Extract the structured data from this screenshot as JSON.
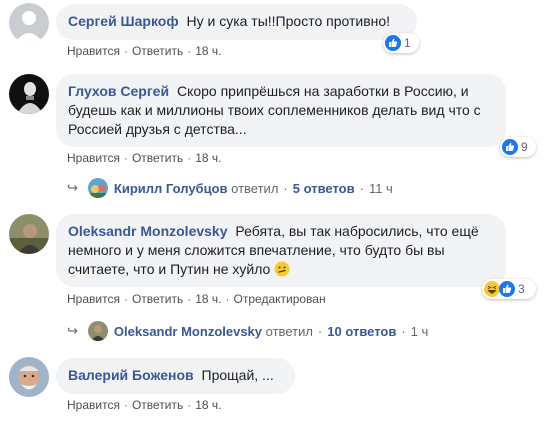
{
  "colors": {
    "link": "#385898",
    "bubble": "#f2f3f5",
    "muted": "#606770",
    "like_blue": "#1877f2"
  },
  "labels": {
    "like": "Нравится",
    "reply": "Ответить",
    "dot": "·",
    "replied_suffix": "ответил"
  },
  "comments": [
    {
      "author": "Сергей Шаркоф",
      "text": "Ну и сука ты!!Просто противно!",
      "time": "18 ч.",
      "reaction_icons": [
        "like-icon"
      ],
      "reaction_count": "1"
    },
    {
      "author": "Глухов Сергей",
      "text": "Скоро припрёшься на заработки в Россию, и будешь как и миллионы твоих соплеменников делать вид что с Россией друзья с детства...",
      "time": "18 ч.",
      "reaction_icons": [
        "like-icon"
      ],
      "reaction_count": "9",
      "replies": {
        "replier": "Кирилл Голубцов",
        "count_text": "5 ответов",
        "time": "11 ч"
      }
    },
    {
      "author": "Oleksandr Monzolevsky",
      "text": "Ребята, вы так набросились, что ещё немного и у меня сложится впечатление, что будто бы вы считаете, что и Путин не хуйло",
      "time": "18 ч.",
      "edited": "Отредактирован",
      "text_emoji": "smirk-emoji",
      "reaction_icons": [
        "haha-icon",
        "like-icon"
      ],
      "reaction_count": "3",
      "replies": {
        "replier": "Oleksandr Monzolevsky",
        "count_text": "10 ответов",
        "time": "1 ч"
      }
    },
    {
      "author": "Валерий Боженов",
      "text": "Прощай, ...",
      "time": "18 ч."
    }
  ]
}
